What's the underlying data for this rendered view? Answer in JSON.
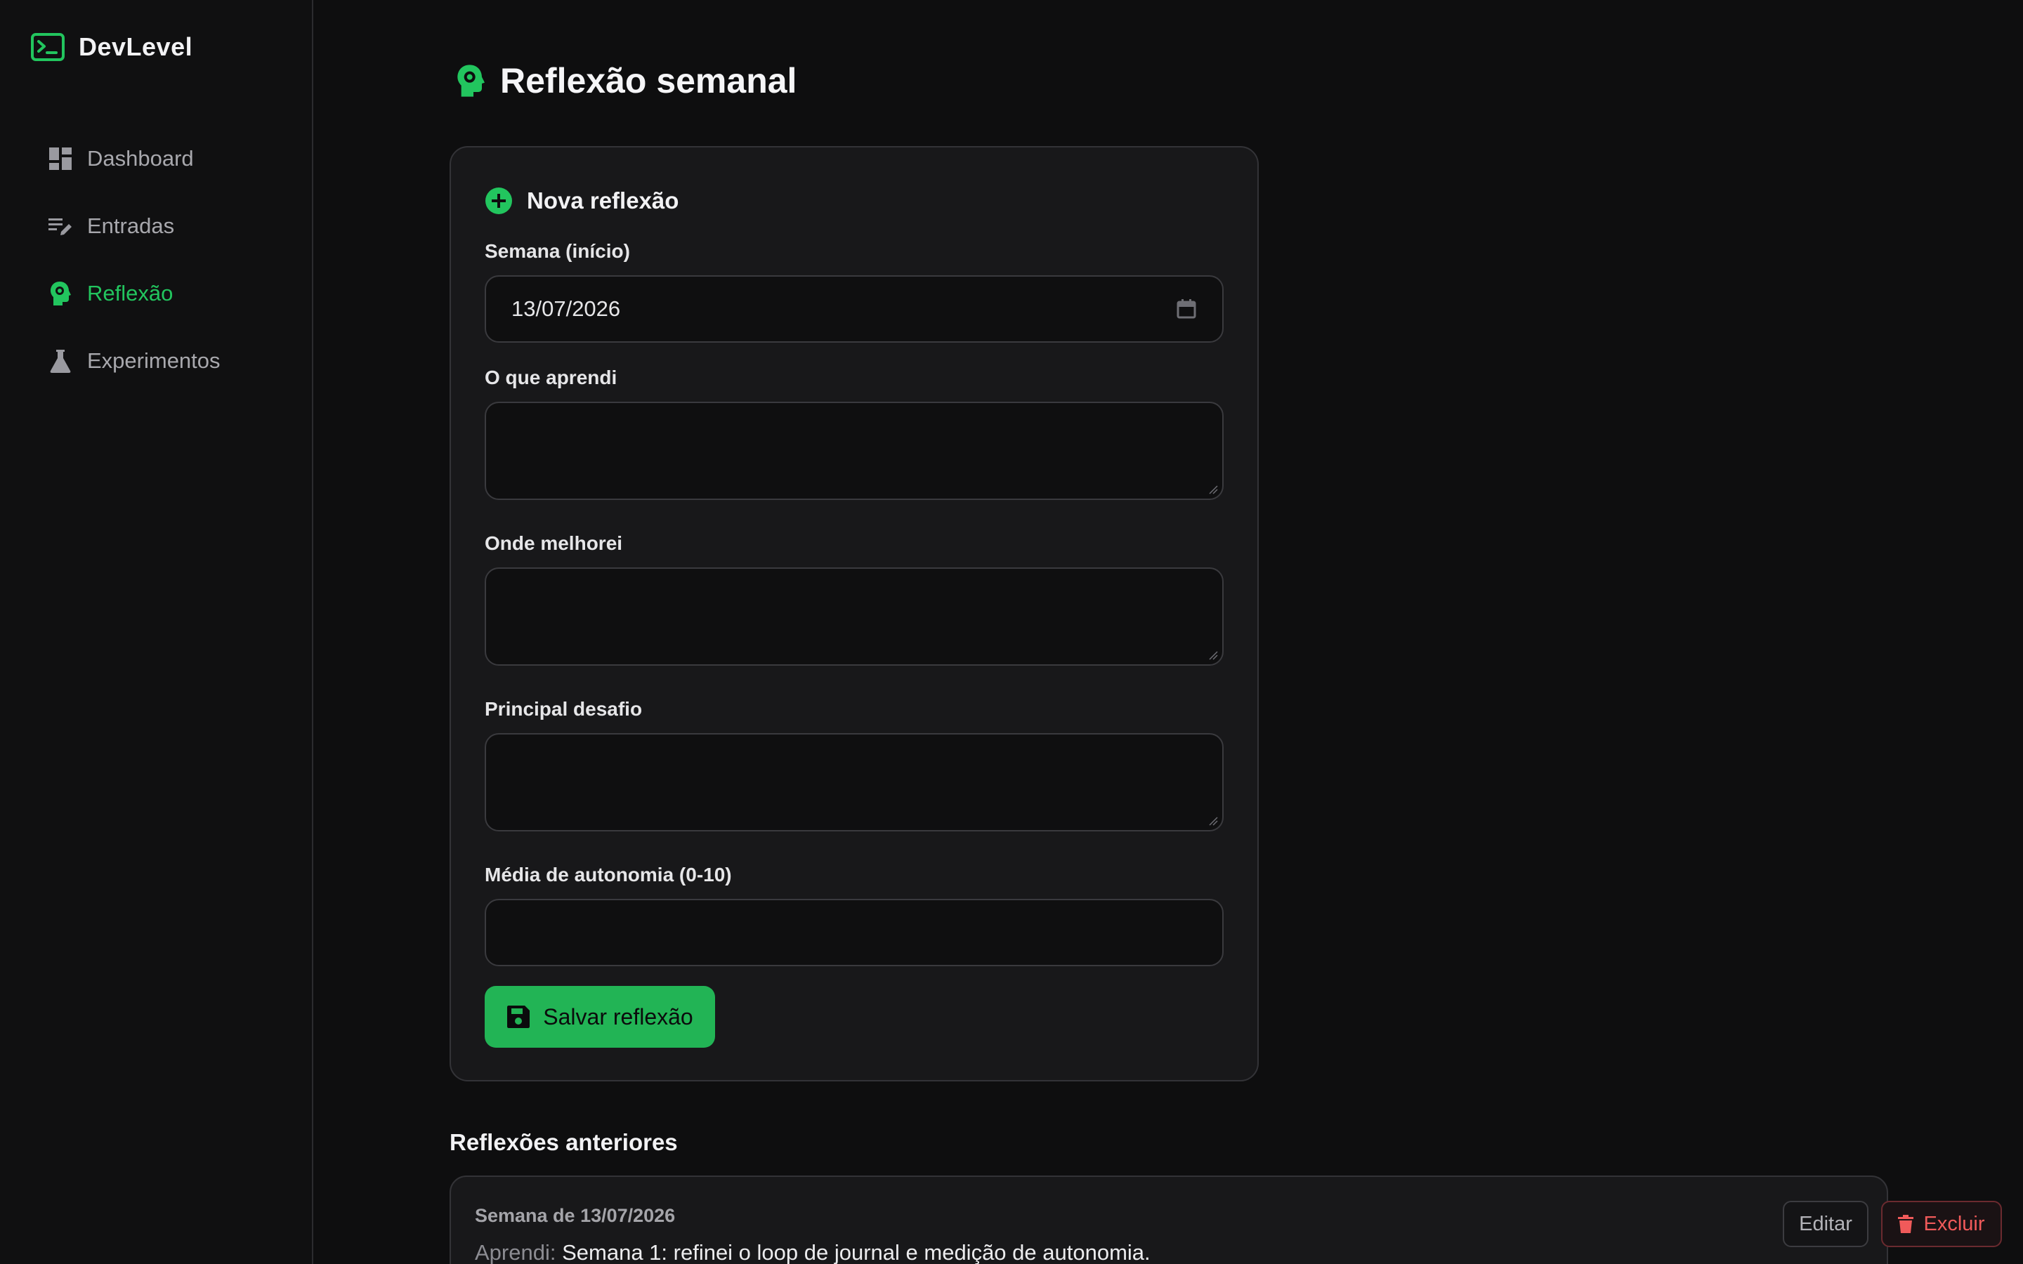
{
  "app": {
    "name": "DevLevel",
    "accent": "#22c55e"
  },
  "sidebar": {
    "items": [
      {
        "label": "Dashboard",
        "icon": "dashboard-icon",
        "active": false
      },
      {
        "label": "Entradas",
        "icon": "edit-list-icon",
        "active": false
      },
      {
        "label": "Reflexão",
        "icon": "head-gear-icon",
        "active": true
      },
      {
        "label": "Experimentos",
        "icon": "flask-icon",
        "active": false
      }
    ]
  },
  "page": {
    "title": "Reflexão semanal",
    "icon": "head-gear-icon"
  },
  "form": {
    "title": "Nova reflexão",
    "icon": "plus-circle-icon",
    "week_label": "Semana (início)",
    "week_value": "13/07/2026",
    "learned_label": "O que aprendi",
    "learned_value": "",
    "improved_label": "Onde melhorei",
    "improved_value": "",
    "challenge_label": "Principal desafio",
    "challenge_value": "",
    "autonomy_label": "Média de autonomia (0-10)",
    "autonomy_value": "",
    "save_label": "Salvar reflexão",
    "save_icon": "save-icon"
  },
  "history": {
    "title": "Reflexões anteriores",
    "entries": [
      {
        "week": "Semana de 13/07/2026",
        "learned_prefix": "Aprendi:",
        "learned_text": "Semana 1: refinei o loop de journal e medição de autonomia.",
        "edit_label": "Editar",
        "delete_label": "Excluir",
        "delete_icon": "trash-icon"
      }
    ]
  },
  "colors": {
    "danger": "#f05a5a",
    "button": "#22b455"
  }
}
